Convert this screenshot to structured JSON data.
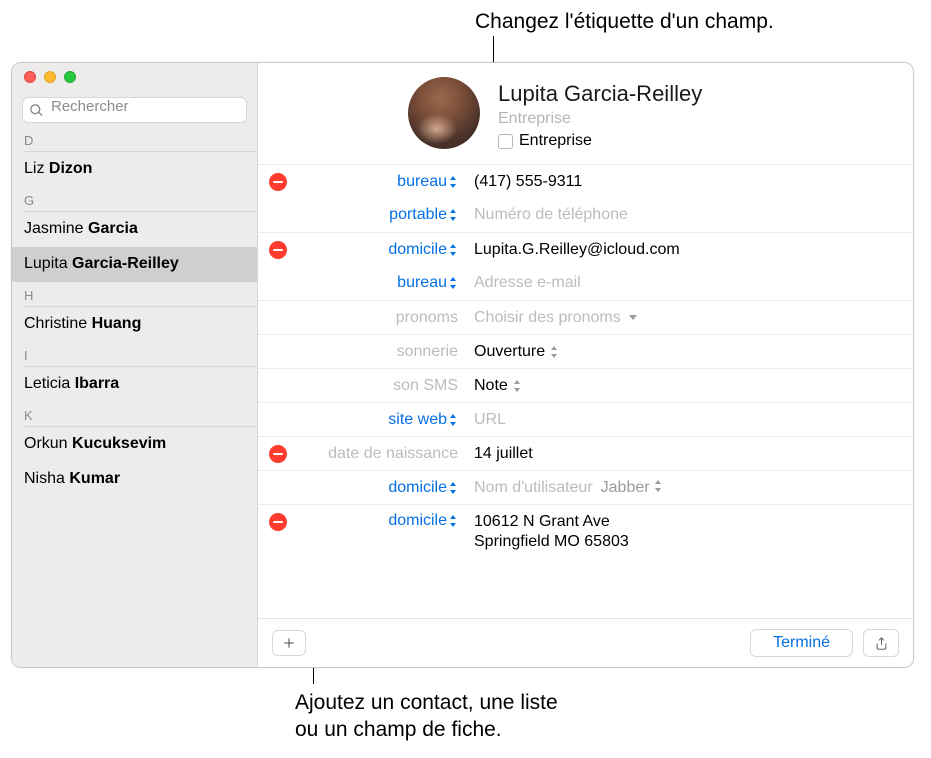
{
  "callouts": {
    "top": "Changez l'étiquette d'un champ.",
    "bottom_line1": "Ajoutez un contact, une liste",
    "bottom_line2": "ou un champ de fiche."
  },
  "search": {
    "placeholder": "Rechercher"
  },
  "sidebar": {
    "sections": [
      {
        "letter": "D",
        "items": [
          {
            "first": "Liz",
            "last": "Dizon"
          }
        ]
      },
      {
        "letter": "G",
        "items": [
          {
            "first": "Jasmine",
            "last": "Garcia"
          },
          {
            "first": "Lupita",
            "last": "Garcia-Reilley",
            "selected": true
          }
        ]
      },
      {
        "letter": "H",
        "items": [
          {
            "first": "Christine",
            "last": "Huang"
          }
        ]
      },
      {
        "letter": "I",
        "items": [
          {
            "first": "Leticia",
            "last": "Ibarra"
          }
        ]
      },
      {
        "letter": "K",
        "items": [
          {
            "first": "Orkun",
            "last": "Kucuksevim"
          },
          {
            "first": "Nisha",
            "last": "Kumar"
          }
        ]
      }
    ]
  },
  "contact": {
    "name": "Lupita  Garcia-Reilley",
    "company_placeholder": "Entreprise",
    "company_checkbox_label": "Entreprise"
  },
  "fields": {
    "phone_office_label": "bureau",
    "phone_office_value": "(417) 555-9311",
    "phone_mobile_label": "portable",
    "phone_mobile_placeholder": "Numéro de téléphone",
    "email_home_label": "domicile",
    "email_home_value": "Lupita.G.Reilley@icloud.com",
    "email_office_label": "bureau",
    "email_office_placeholder": "Adresse e-mail",
    "pronouns_label": "pronoms",
    "pronouns_value": "Choisir des pronoms",
    "ringtone_label": "sonnerie",
    "ringtone_value": "Ouverture",
    "texttone_label": "son SMS",
    "texttone_value": "Note",
    "web_label": "site web",
    "web_placeholder": "URL",
    "birthday_label": "date de naissance",
    "birthday_value": "14 juillet",
    "im_label": "domicile",
    "im_placeholder": "Nom d'utilisateur",
    "im_service": "Jabber",
    "address_label": "domicile",
    "address_line1": "10612 N Grant Ave",
    "address_line2": "Springfield MO 65803"
  },
  "toolbar": {
    "done": "Terminé"
  }
}
